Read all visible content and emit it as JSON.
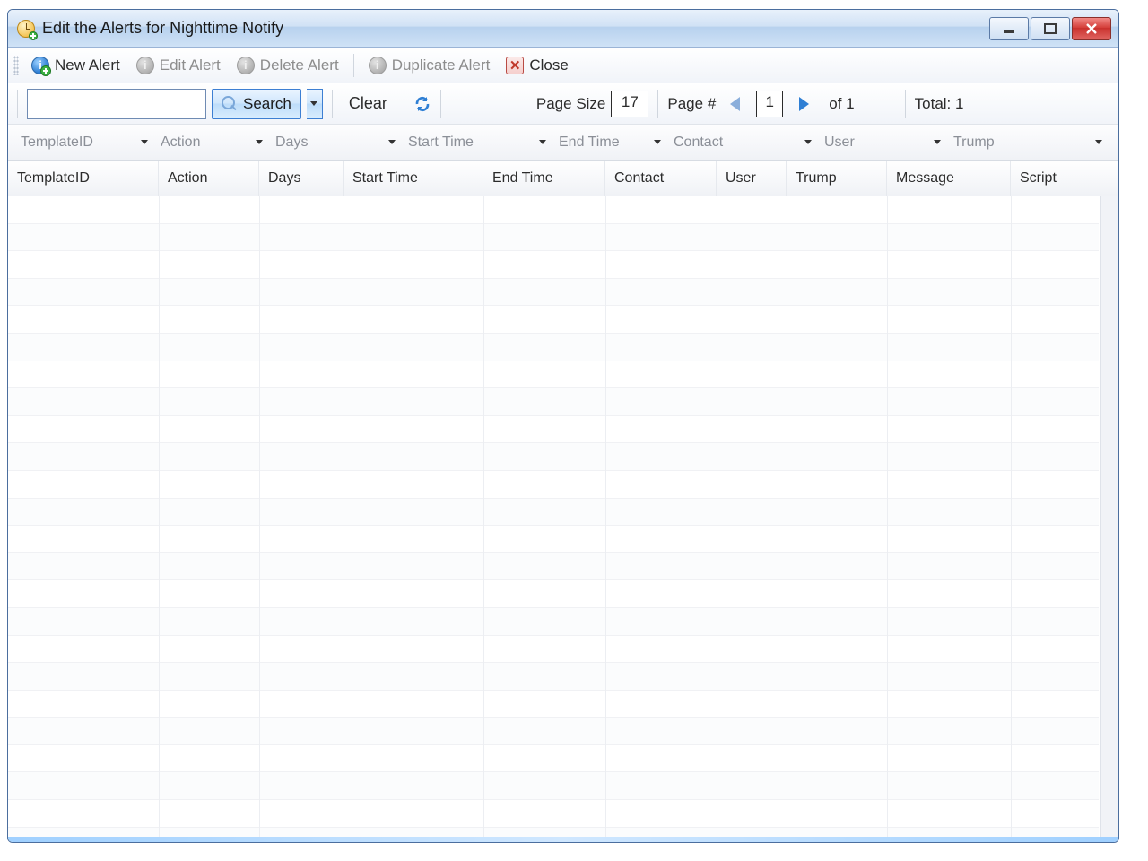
{
  "window": {
    "title": "Edit the Alerts for Nighttime Notify"
  },
  "toolbar": {
    "new_alert": "New Alert",
    "edit_alert": "Edit Alert",
    "delete_alert": "Delete Alert",
    "duplicate_alert": "Duplicate Alert",
    "close": "Close"
  },
  "searchbar": {
    "search_value": "",
    "search_label": "Search",
    "clear_label": "Clear",
    "page_size_label": "Page Size",
    "page_size_value": "17",
    "page_num_label": "Page #",
    "page_num_value": "1",
    "page_of_label": "of 1",
    "total_label": "Total: 1"
  },
  "filters": [
    "TemplateID",
    "Action",
    "Days",
    "Start Time",
    "End Time",
    "Contact",
    "User",
    "Trump"
  ],
  "columns": [
    "TemplateID",
    "Action",
    "Days",
    "Start Time",
    "End Time",
    "Contact",
    "User",
    "Trump",
    "Message",
    "Script"
  ],
  "rows": []
}
